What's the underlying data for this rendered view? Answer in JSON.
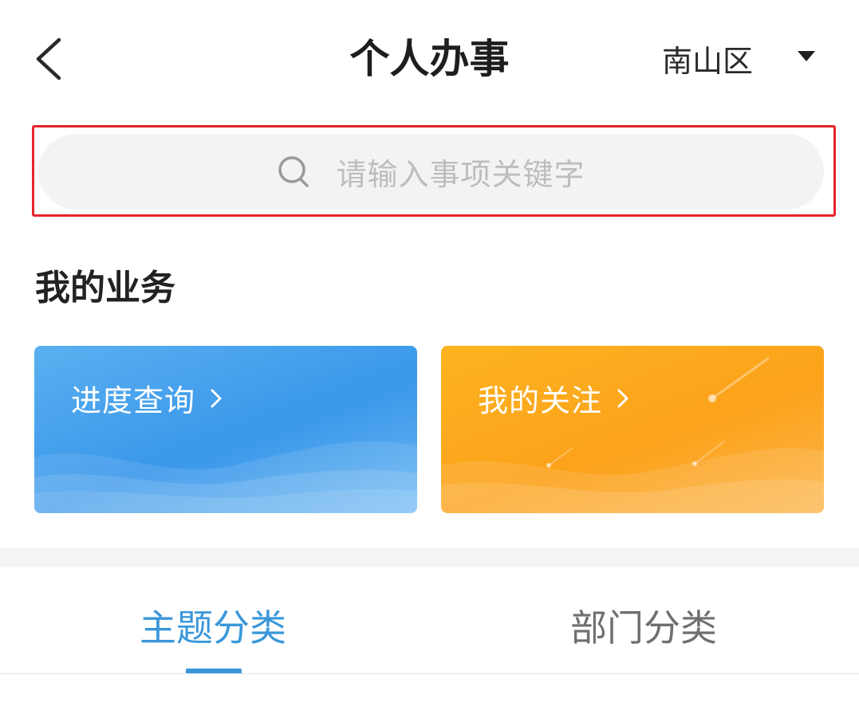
{
  "header": {
    "title": "个人办事",
    "region": "南山区"
  },
  "search": {
    "placeholder": "请输入事项关键字"
  },
  "section": {
    "title": "我的业务"
  },
  "cards": [
    {
      "label": "进度查询",
      "color": "#3a97ea"
    },
    {
      "label": "我的关注",
      "color": "#fca21b"
    }
  ],
  "tabs": [
    {
      "label": "主题分类",
      "active": true
    },
    {
      "label": "部门分类",
      "active": false
    }
  ],
  "colors": {
    "accent": "#3a97da",
    "highlight_border": "#e5242b"
  },
  "icons": {
    "back": "chevron-left-icon",
    "region_dropdown": "caret-down-icon",
    "search": "search-icon",
    "card_arrow": "chevron-right-icon"
  }
}
